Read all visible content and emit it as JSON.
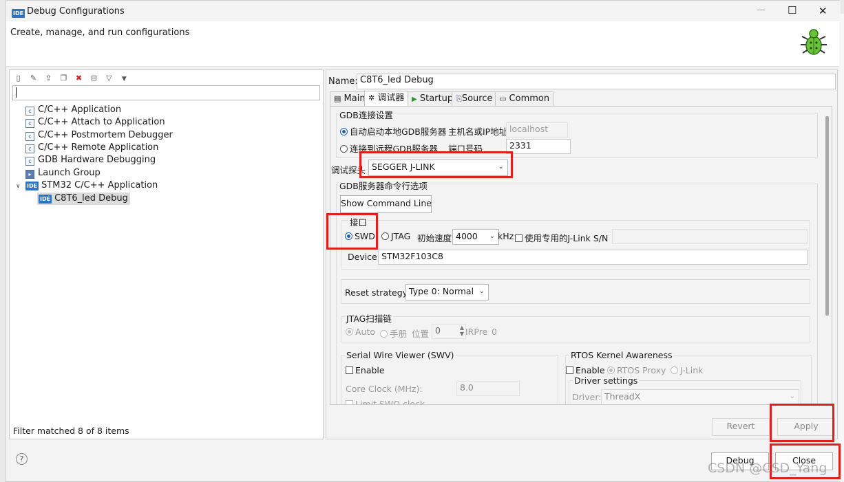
{
  "window": {
    "title": "Debug Configurations",
    "icon_text": "IDE",
    "minimize_label": "—",
    "maximize_label": "☐",
    "close_label": "✕"
  },
  "header": {
    "subtitle": "Create, manage, and run configurations"
  },
  "left": {
    "filter_value": "",
    "tree": [
      {
        "label": "C/C++ Application",
        "icon": "c-config-icon"
      },
      {
        "label": "C/C++ Attach to Application",
        "icon": "c-config-icon"
      },
      {
        "label": "C/C++ Postmortem Debugger",
        "icon": "c-config-icon"
      },
      {
        "label": "C/C++ Remote Application",
        "icon": "c-config-icon"
      },
      {
        "label": "GDB Hardware Debugging",
        "icon": "c-config-icon"
      },
      {
        "label": "Launch Group",
        "icon": "launch-group-icon"
      },
      {
        "label": "STM32 C/C++ Application",
        "icon": "ide-icon",
        "expanded": true
      },
      {
        "label": "C8T6_led Debug",
        "icon": "ide-icon",
        "selected": true
      }
    ],
    "status": "Filter matched 8 of 8 items"
  },
  "right": {
    "name_label": "Name:",
    "name_value": "C8T6_led Debug",
    "tabs": [
      {
        "label": "Main",
        "icon": "main-tab-icon"
      },
      {
        "label": "调试器",
        "icon": "debugger-tab-icon",
        "active": true
      },
      {
        "label": "Startup",
        "icon": "startup-tab-icon"
      },
      {
        "label": "Source",
        "icon": "source-tab-icon"
      },
      {
        "label": "Common",
        "icon": "common-tab-icon"
      }
    ],
    "gdb_group": "GDB连接设置",
    "gdb_auto": "自动启动本地GDB服务器",
    "host_label": "主机名或IP地址",
    "host_value": "localhost",
    "gdb_remote": "连接到远程GDB服务器",
    "port_label": "端口号码",
    "port_value": "2331",
    "probe_label": "调试探头",
    "probe_value": "SEGGER J-LINK",
    "server_group": "GDB服务器命令行选项",
    "show_cmd": "Show Command Line",
    "interface_label": "接口",
    "swd": "SWD",
    "jtag": "JTAG",
    "speed_label": "初始速度",
    "speed_value": "4000",
    "khz": "kHz",
    "sn_label": "使用专用的J-Link S/N",
    "device_label": "Device",
    "device_value": "STM32F103C8",
    "reset_label": "Reset strategy",
    "reset_value": "Type 0: Normal",
    "jtag_group": "JTAG扫描链",
    "auto": "Auto",
    "manual": "手册",
    "pos_label": "位置",
    "pos_value": "0",
    "irpre_label": "IRPre",
    "irpre_value": "0",
    "swv_group": "Serial Wire Viewer (SWV)",
    "swv_enable": "Enable",
    "core_clock_label": "Core Clock (MHz):",
    "core_clock_value": "8.0",
    "limit_swo": "Limit SWO clock",
    "rtos_group": "RTOS Kernel Awareness",
    "rtos_enable": "Enable",
    "rtos_proxy": "RTOS Proxy",
    "rtos_jlink": "J-Link",
    "driver_settings": "Driver settings",
    "driver_label": "Driver:",
    "driver_value": "ThreadX",
    "revert": "Revert",
    "apply": "Apply"
  },
  "footer": {
    "help": "?",
    "debug": "Debug",
    "close": "Close"
  },
  "watermark": "CSDN @CSD_Yang",
  "colors": {
    "highlight_box": "#e0201a",
    "accent": "#1a5fb4"
  }
}
